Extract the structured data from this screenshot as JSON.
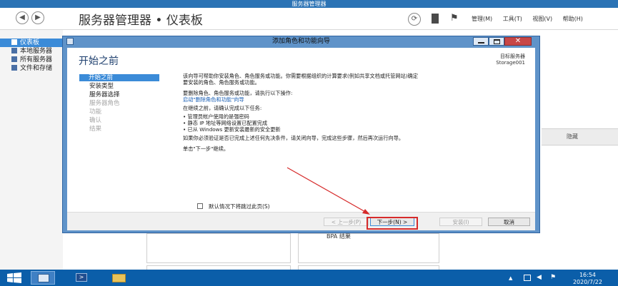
{
  "window_title": "服务器管理器",
  "header": {
    "breadcrumb": "服务器管理器 • 仪表板",
    "menu": [
      "管理(M)",
      "工具(T)",
      "视图(V)",
      "帮助(H)"
    ]
  },
  "sidebar": {
    "items": [
      {
        "label": "仪表板",
        "selected": true
      },
      {
        "label": "本地服务器",
        "selected": false
      },
      {
        "label": "所有服务器",
        "selected": false
      },
      {
        "label": "文件和存储",
        "selected": false
      }
    ]
  },
  "background": {
    "hide_label": "隐藏",
    "bpa_label": "BPA 结果"
  },
  "wizard": {
    "title": "添加角色和功能向导",
    "heading": "开始之前",
    "target_server_label": "目标服务器",
    "target_server_name": "Storage001",
    "steps": [
      {
        "label": "开始之前",
        "state": "selected"
      },
      {
        "label": "安装类型",
        "state": "normal"
      },
      {
        "label": "服务器选择",
        "state": "normal"
      },
      {
        "label": "服务器角色",
        "state": "disabled"
      },
      {
        "label": "功能",
        "state": "disabled"
      },
      {
        "label": "确认",
        "state": "disabled"
      },
      {
        "label": "结果",
        "state": "disabled"
      }
    ],
    "content": {
      "intro_line1": "该向导可帮助你安装角色、角色服务或功能。你需要根据组织的计算要求(例如共享文档或托管网站)确定",
      "intro_line2": "要安装的角色、角色服务或功能。",
      "remove_line": "要删除角色、角色服务或功能，请执行以下操作:",
      "remove_link": "启动\"删除角色和功能\"向导",
      "before_line": "在继续之前，请确认完成以下任务:",
      "tasks": [
        "管理员帐户使用的是强密码",
        "静态 IP 地址等网络设置已配置完成",
        "已从 Windows 更新安装最新的安全更新"
      ],
      "verify_line": "如果你必须验证是否已完成上述任何先决条件，请关闭向导，完成这些步骤，然后再次运行向导。",
      "continue_line": "单击\"下一步\"继续。"
    },
    "skip_checkbox_label": "默认情况下将跳过此页(S)",
    "buttons": {
      "prev": "< 上一步(P)",
      "next": "下一步(N) >",
      "install": "安装(I)",
      "cancel": "取消"
    }
  },
  "taskbar": {
    "time": "16:54",
    "date": "2020/7/22"
  },
  "colors": {
    "accent": "#3b8bd8",
    "title_bar": "#2b73b5",
    "taskbar": "#0b5ea9",
    "highlight_box": "#d62a2a"
  }
}
